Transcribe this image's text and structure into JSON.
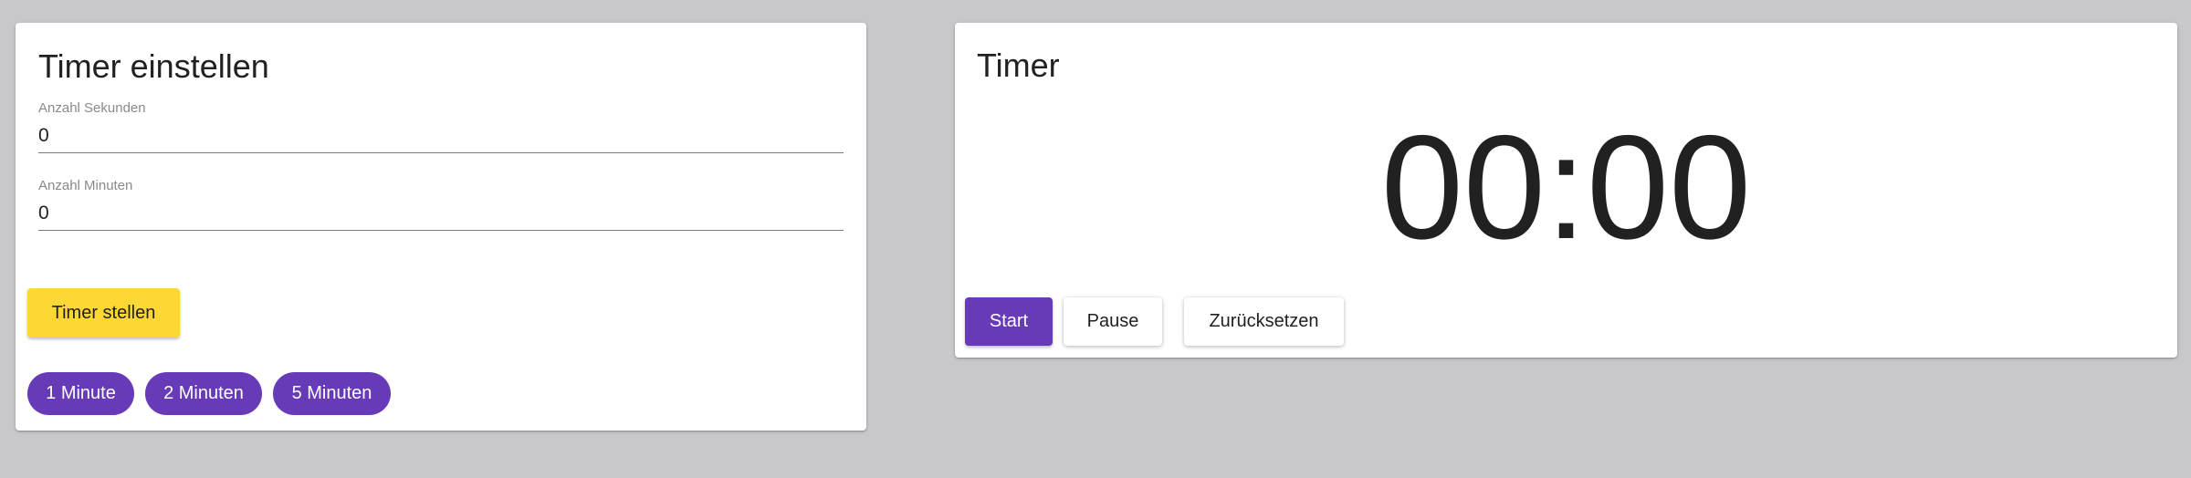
{
  "settings": {
    "title": "Timer einstellen",
    "seconds_label": "Anzahl Sekunden",
    "seconds_value": "0",
    "minutes_label": "Anzahl Minuten",
    "minutes_value": "0",
    "set_button_label": "Timer stellen",
    "presets": [
      {
        "label": "1 Minute"
      },
      {
        "label": "2 Minuten"
      },
      {
        "label": "5 Minuten"
      }
    ]
  },
  "timer": {
    "title": "Timer",
    "display": "00:00",
    "start_label": "Start",
    "pause_label": "Pause",
    "reset_label": "Zurücksetzen"
  },
  "colors": {
    "background": "#c8c7cb",
    "primary": "#673ab7",
    "accent": "#fdd835",
    "card": "#ffffff"
  }
}
